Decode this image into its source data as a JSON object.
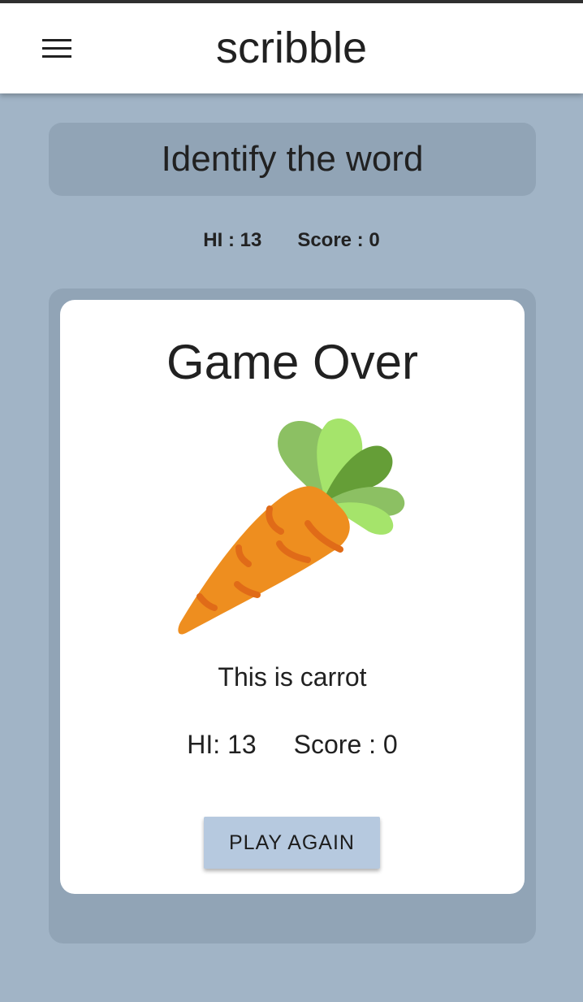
{
  "appbar": {
    "title": "scribble",
    "menu_icon": "hamburger-menu-icon"
  },
  "prompt": {
    "text": "Identify the word"
  },
  "stats": {
    "hi": "HI : 13",
    "score": "Score : 0"
  },
  "result": {
    "heading": "Game Over",
    "image_icon": "carrot-image",
    "answer": "This is carrot",
    "hi": "HI: 13",
    "score": "Score : 0",
    "button_label": "PLAY AGAIN"
  },
  "colors": {
    "background": "#a1b4c6",
    "panel": "#91a4b6",
    "card": "#ffffff",
    "button": "#b6c9df"
  }
}
